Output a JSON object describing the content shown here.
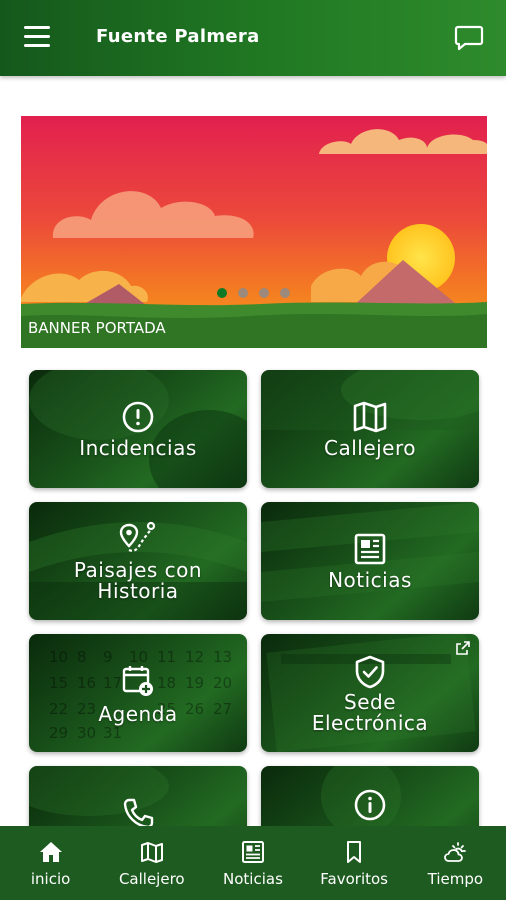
{
  "app": {
    "title": "Fuente Palmera",
    "menu_icon": "menu-icon",
    "chat_icon": "chat-icon"
  },
  "colors": {
    "primary": "#217a23",
    "nav": "#1d5b20",
    "dot_active": "#0f7a26",
    "dot_inactive": "#8c8c8c"
  },
  "banner": {
    "caption": "BANNER PORTADA",
    "slides": 4,
    "active_slide": 1
  },
  "tiles": [
    {
      "label": "Incidencias",
      "icon": "alert-circle-icon"
    },
    {
      "label": "Callejero",
      "icon": "map-icon"
    },
    {
      "label": "Paisajes con\nHistoria",
      "icon": "route-pin-icon"
    },
    {
      "label": "Noticias",
      "icon": "newspaper-icon"
    },
    {
      "label": "Agenda",
      "icon": "calendar-add-icon"
    },
    {
      "label": "Sede\nElectrónica",
      "icon": "shield-check-icon",
      "external": true
    },
    {
      "label": "",
      "icon": "phone-icon"
    },
    {
      "label": "",
      "icon": "info-icon"
    }
  ],
  "bottom_nav": [
    {
      "label": "inicio",
      "icon": "home-icon"
    },
    {
      "label": "Callejero",
      "icon": "map-icon"
    },
    {
      "label": "Noticias",
      "icon": "newspaper-icon"
    },
    {
      "label": "Favoritos",
      "icon": "bookmark-icon"
    },
    {
      "label": "Tiempo",
      "icon": "weather-icon"
    }
  ]
}
